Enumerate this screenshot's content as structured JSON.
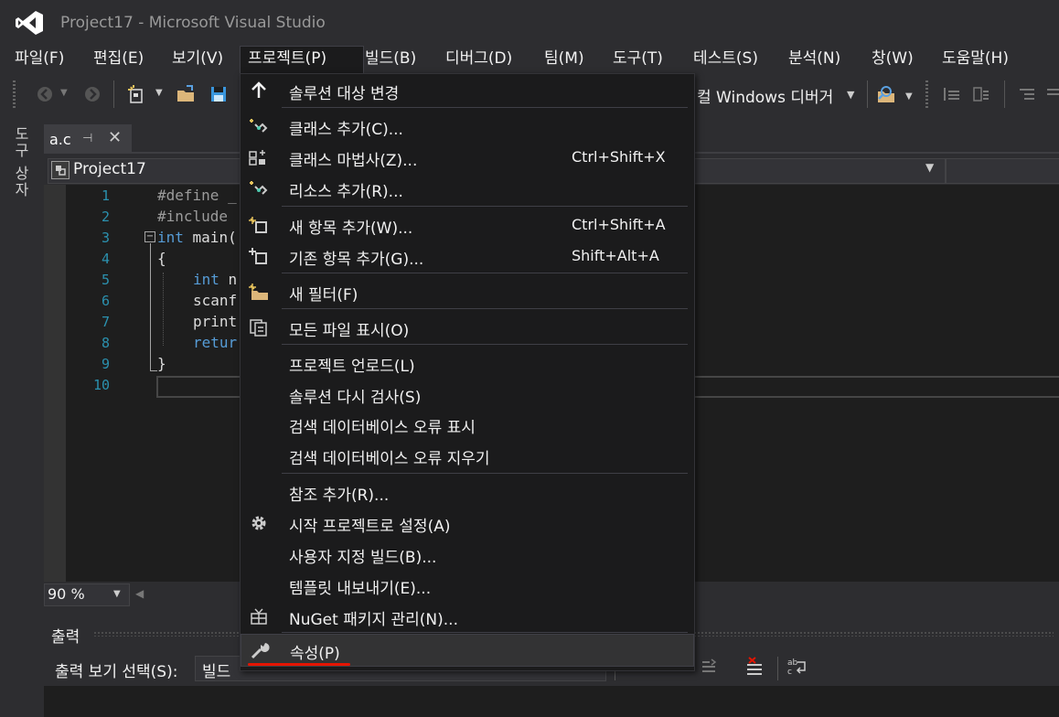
{
  "window": {
    "title": "Project17 - Microsoft Visual Studio"
  },
  "menubar": [
    {
      "label": "파일(F)"
    },
    {
      "label": "편집(E)"
    },
    {
      "label": "보기(V)"
    },
    {
      "label": "프로젝트(P)"
    },
    {
      "label": "빌드(B)"
    },
    {
      "label": "디버그(D)"
    },
    {
      "label": "팀(M)"
    },
    {
      "label": "도구(T)"
    },
    {
      "label": "테스트(S)"
    },
    {
      "label": "분석(N)"
    },
    {
      "label": "창(W)"
    },
    {
      "label": "도움말(H)"
    }
  ],
  "toolbar": {
    "debugger_label": "컬 Windows 디버거"
  },
  "toolbox": {
    "label": "도구 상자"
  },
  "document": {
    "tab_label": "a.c",
    "project_dropdown": "Project17"
  },
  "editor": {
    "lines": [
      {
        "num": "1",
        "pre": "#define _",
        "kw": "",
        "rest": ""
      },
      {
        "num": "2",
        "pre": "#include ",
        "kw": "",
        "rest": ""
      },
      {
        "num": "3",
        "pre": "",
        "kw": "int",
        "rest": " main("
      },
      {
        "num": "4",
        "pre": "",
        "kw": "",
        "rest": "{"
      },
      {
        "num": "5",
        "pre": "",
        "kw": "int",
        "rest": " n"
      },
      {
        "num": "6",
        "pre": "",
        "kw": "",
        "rest": "scanf"
      },
      {
        "num": "7",
        "pre": "",
        "kw": "",
        "rest": "print"
      },
      {
        "num": "8",
        "pre": "",
        "kw": "retur",
        "rest": ""
      },
      {
        "num": "9",
        "pre": "",
        "kw": "",
        "rest": "}"
      },
      {
        "num": "10",
        "pre": "",
        "kw": "",
        "rest": ""
      }
    ],
    "zoom": "90 %"
  },
  "output": {
    "title": "출력",
    "source_label": "출력 보기 선택(S):",
    "source_value": "빌드"
  },
  "project_menu": {
    "items": [
      {
        "label": "솔루션 대상 변경",
        "shortcut": "",
        "icon": "up-arrow-icon"
      },
      {
        "label": "클래스 추가(C)...",
        "shortcut": "",
        "icon": "add-class-icon"
      },
      {
        "label": "클래스 마법사(Z)...",
        "shortcut": "Ctrl+Shift+X",
        "icon": "class-wizard-icon"
      },
      {
        "label": "리소스 추가(R)...",
        "shortcut": "",
        "icon": "add-resource-icon"
      },
      {
        "label": "새 항목 추가(W)...",
        "shortcut": "Ctrl+Shift+A",
        "icon": "new-item-icon"
      },
      {
        "label": "기존 항목 추가(G)...",
        "shortcut": "Shift+Alt+A",
        "icon": "existing-item-icon"
      },
      {
        "label": "새 필터(F)",
        "shortcut": "",
        "icon": "new-filter-icon"
      },
      {
        "label": "모든 파일 표시(O)",
        "shortcut": "",
        "icon": "show-all-files-icon"
      },
      {
        "label": "프로젝트 언로드(L)",
        "shortcut": "",
        "icon": ""
      },
      {
        "label": "솔루션 다시 검사(S)",
        "shortcut": "",
        "icon": ""
      },
      {
        "label": "검색 데이터베이스 오류 표시",
        "shortcut": "",
        "icon": ""
      },
      {
        "label": "검색 데이터베이스 오류 지우기",
        "shortcut": "",
        "icon": ""
      },
      {
        "label": "참조 추가(R)...",
        "shortcut": "",
        "icon": ""
      },
      {
        "label": "시작 프로젝트로 설정(A)",
        "shortcut": "",
        "icon": "gear-icon"
      },
      {
        "label": "사용자 지정 빌드(B)...",
        "shortcut": "",
        "icon": ""
      },
      {
        "label": "템플릿 내보내기(E)...",
        "shortcut": "",
        "icon": ""
      },
      {
        "label": "NuGet 패키지 관리(N)...",
        "shortcut": "",
        "icon": "nuget-icon"
      },
      {
        "label": "속성(P)",
        "shortcut": "",
        "icon": "wrench-icon"
      }
    ]
  },
  "colors": {
    "accent": "#68217a",
    "background": "#2d2d30",
    "editor_bg": "#1e1e1e",
    "keyword": "#569cd6",
    "line_number": "#2b91af",
    "annotation_underline": "#e51400"
  }
}
